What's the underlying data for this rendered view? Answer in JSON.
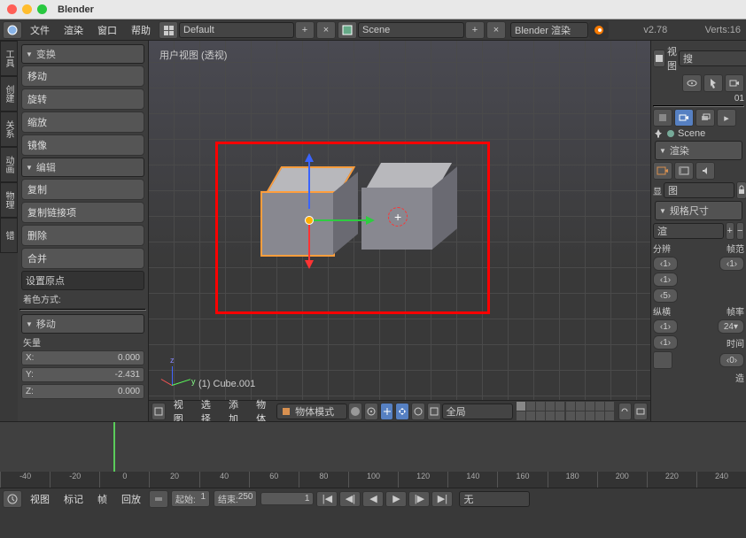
{
  "app": {
    "title": "Blender"
  },
  "topbar": {
    "menus": [
      "文件",
      "渲染",
      "窗口",
      "帮助"
    ],
    "layout": "Default",
    "scene": "Scene",
    "renderer": "Blender 渲染",
    "version": "v2.78",
    "stats": "Verts:16"
  },
  "leftTabs": [
    "工具",
    "创建",
    "关系",
    "动画",
    "物理",
    "错"
  ],
  "transform": {
    "header": "变换",
    "move": "移动",
    "rotate": "旋转",
    "scale": "缩放",
    "mirror": "镜像"
  },
  "edit": {
    "header": "编辑",
    "dup": "复制",
    "duplink": "复制链接项",
    "del": "删除",
    "join": "合并",
    "origin": "设置原点",
    "shade": "着色方式:"
  },
  "lastop": {
    "header": "移动",
    "vector": "矢量",
    "x_lbl": "X:",
    "x_val": "0.000",
    "y_lbl": "Y:",
    "y_val": "-2.431",
    "z_lbl": "Z:",
    "z_val": "0.000"
  },
  "viewport": {
    "label": "用户视图 (透视)",
    "object": "(1) Cube.001",
    "menus": [
      "视图",
      "选择",
      "添加",
      "物体"
    ],
    "mode": "物体模式",
    "orient": "全局"
  },
  "right": {
    "view_lbl": "视图",
    "search": "搜",
    "layer_num": "01",
    "scene": "Scene",
    "render_hdr": "渲染",
    "show_lbl": "显",
    "img_lbl": "图",
    "dims_hdr": "规格尺寸",
    "render_lbl": "渲",
    "res_lbl": "分辨",
    "fs_lbl": "帧范",
    "r1": "1",
    "r2": "1",
    "r3": "5",
    "fs1": "1",
    "aspect_lbl": "纵横",
    "fps_lbl": "帧率",
    "a1": "1",
    "fps": "24",
    "time_lbl": "时间",
    "a2": "1",
    "a3": "0",
    "make_lbl": "造"
  },
  "timeline": {
    "ticks": [
      "-40",
      "-20",
      "0",
      "20",
      "40",
      "60",
      "80",
      "100",
      "120",
      "140",
      "160",
      "180",
      "200",
      "220",
      "240"
    ],
    "menus": [
      "视图",
      "标记",
      "帧",
      "回放"
    ],
    "start_lbl": "起始:",
    "start_val": "1",
    "end_lbl": "结束:",
    "end_val": "250",
    "cur_val": "1",
    "no_sync": "无"
  }
}
